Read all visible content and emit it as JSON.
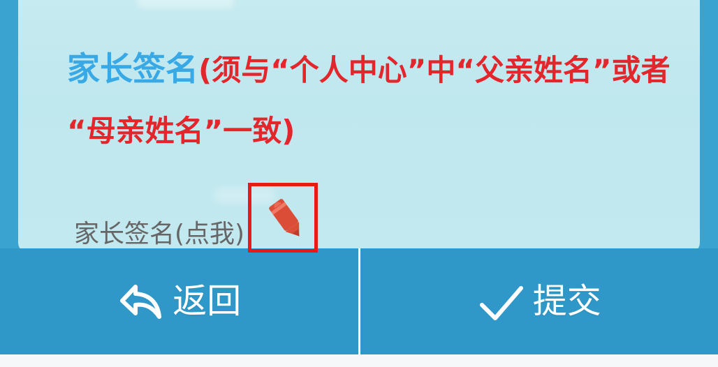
{
  "form": {
    "heading_title": "家长签名",
    "heading_note_line1": "(须与“个人中心”中“父亲姓名”或者",
    "heading_note_line2": "“母亲姓名”一致)",
    "signature_link_label": "家长签名(点我)"
  },
  "actions": {
    "back_label": "返回",
    "submit_label": "提交"
  },
  "icons": {
    "signature_icon": "pencil-icon",
    "back_icon": "back-arrow-icon",
    "submit_icon": "checkmark-icon"
  },
  "colors": {
    "heading_blue": "#39a9e6",
    "note_red": "#e3262c",
    "action_bar_blue": "#2f98c8",
    "highlight_red": "#e91919",
    "pencil_red": "#dc4d38"
  }
}
